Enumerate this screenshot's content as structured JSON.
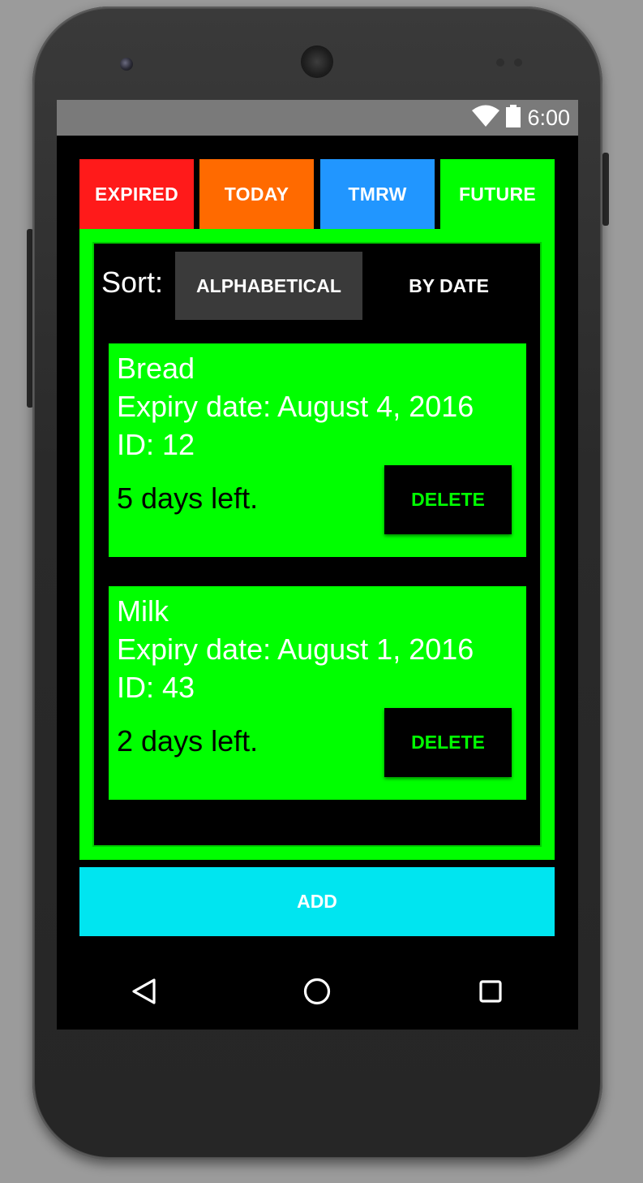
{
  "status_bar": {
    "time": "6:00",
    "wifi_icon": "wifi-icon",
    "battery_icon": "battery-icon"
  },
  "tabs": [
    {
      "label": "EXPIRED",
      "color": "#ff1a1a"
    },
    {
      "label": "TODAY",
      "color": "#ff6a00"
    },
    {
      "label": "TMRW",
      "color": "#2196ff"
    },
    {
      "label": "FUTURE",
      "color": "#00ff00",
      "selected": true
    }
  ],
  "sort": {
    "label": "Sort:",
    "alphabetical_label": "ALPHABETICAL",
    "by_date_label": "BY DATE"
  },
  "items": [
    {
      "name": "Bread",
      "expiry": "Expiry date: August 4, 2016",
      "id": "ID: 12",
      "days_left": "5 days left.",
      "delete_label": "DELETE"
    },
    {
      "name": "Milk",
      "expiry": "Expiry date: August 1, 2016",
      "id": "ID: 43",
      "days_left": "2 days left.",
      "delete_label": "DELETE"
    }
  ],
  "add_label": "ADD",
  "colors": {
    "accent_green": "#00ff00",
    "add_cyan": "#00e5f0"
  },
  "nav": {
    "back_icon": "back-icon",
    "home_icon": "home-icon",
    "recents_icon": "recents-icon"
  }
}
